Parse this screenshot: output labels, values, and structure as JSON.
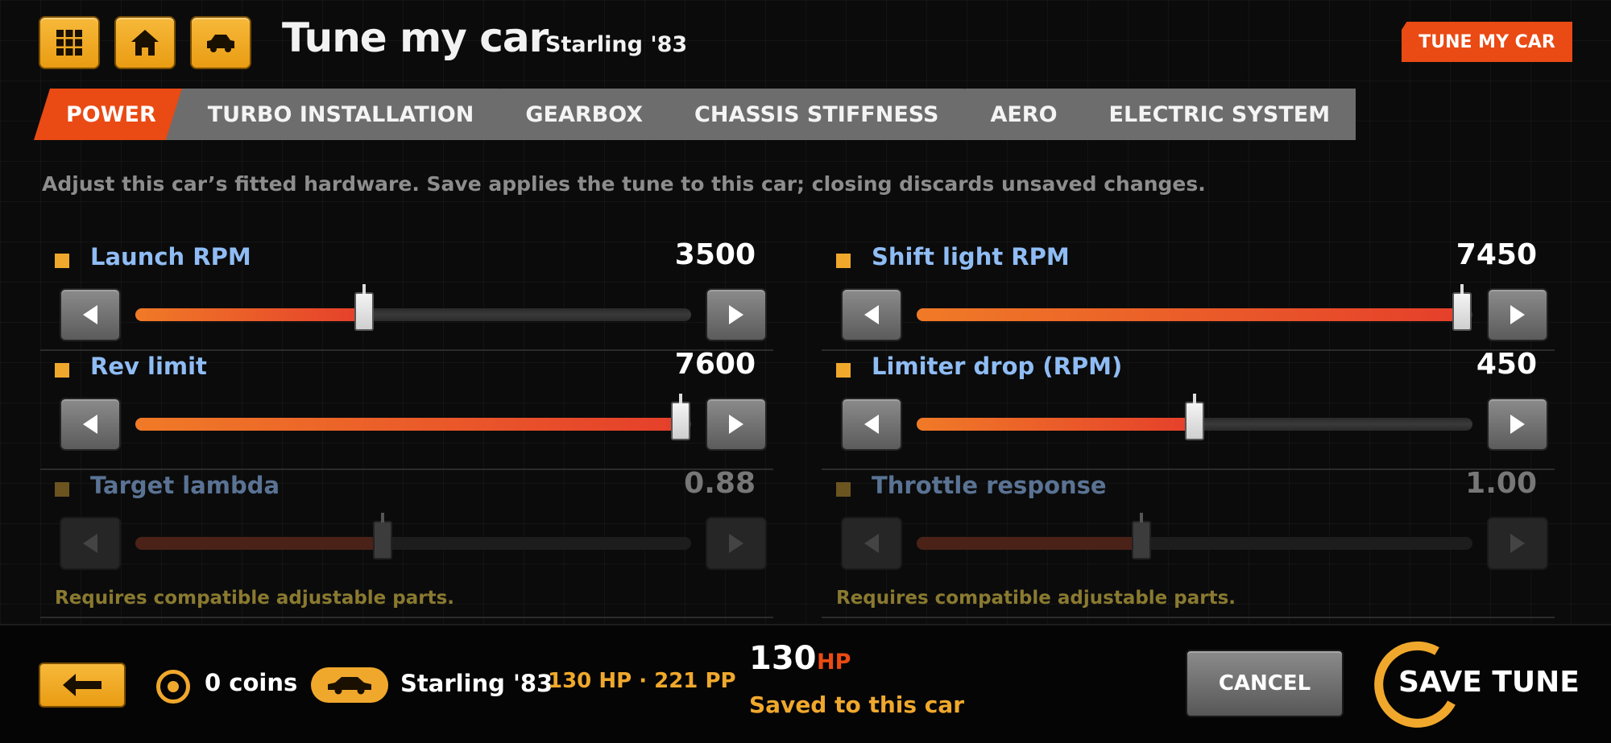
{
  "header": {
    "title": "Tune my car",
    "car_name": "Starling '83",
    "badge": "TUNE MY CAR",
    "buttons": [
      "grid-icon",
      "home-icon",
      "car-icon"
    ]
  },
  "tabs": [
    {
      "label": "POWER",
      "active": true
    },
    {
      "label": "TURBO INSTALLATION",
      "active": false
    },
    {
      "label": "GEARBOX",
      "active": false
    },
    {
      "label": "CHASSIS STIFFNESS",
      "active": false
    },
    {
      "label": "AERO",
      "active": false
    },
    {
      "label": "ELECTRIC SYSTEM",
      "active": false
    }
  ],
  "description": "Adjust this car’s fitted hardware. Save applies the tune to this car; closing discards unsaved changes.",
  "sliders": [
    {
      "label": "Launch RPM",
      "value": "3500",
      "fraction": 0.412,
      "enabled": true
    },
    {
      "label": "Shift light RPM",
      "value": "7450",
      "fraction": 0.981,
      "enabled": true
    },
    {
      "label": "Rev limit",
      "value": "7600",
      "fraction": 0.981,
      "enabled": true
    },
    {
      "label": "Limiter drop (RPM)",
      "value": "450",
      "fraction": 0.5,
      "enabled": true
    },
    {
      "label": "Target lambda",
      "value": "0.88",
      "fraction": 0.445,
      "enabled": false,
      "note": "Requires compatible adjustable parts."
    },
    {
      "label": "Throttle response",
      "value": "1.00",
      "fraction": 0.404,
      "enabled": false,
      "note": "Requires compatible adjustable parts."
    }
  ],
  "footer": {
    "coins": "0 coins",
    "car_name": "Starling '83",
    "stats": "130 HP · 221 PP",
    "hp_value": "130",
    "hp_unit": "HP",
    "saved_status": "Saved to this car",
    "cancel_label": "CANCEL",
    "save_label": "SAVE TUNE"
  },
  "colors": {
    "accent": "#ea4a14",
    "gold": "#f0a82c",
    "label_blue": "#8fbcf4",
    "background": "#0b0b0b"
  }
}
